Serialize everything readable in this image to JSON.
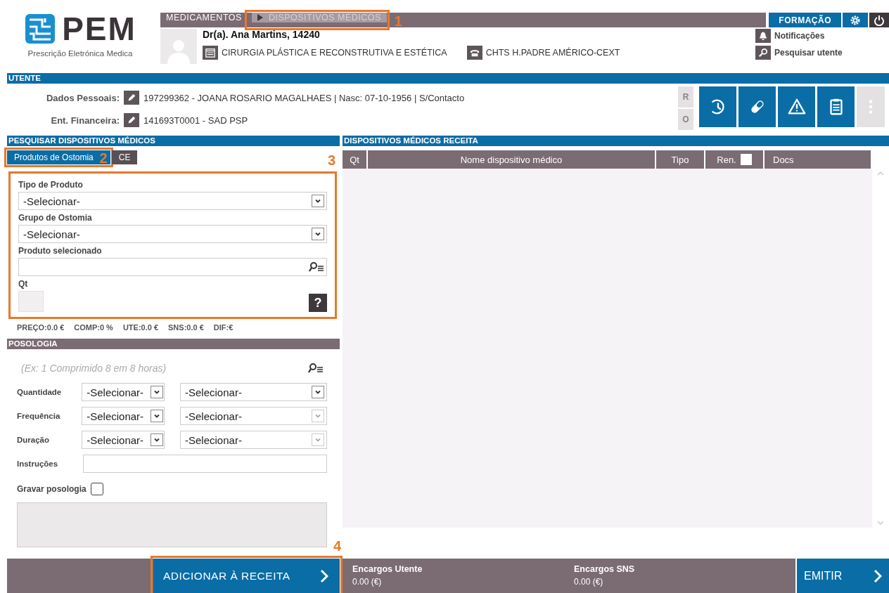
{
  "logo": {
    "name": "PEM",
    "subtitle": "Prescrição Eletrónica Medica"
  },
  "nav_tabs": [
    {
      "label": "MEDICAMENTOS",
      "selected": false
    },
    {
      "label": "DISPOSITIVOS MÉDICOS",
      "selected": true,
      "callout": "1"
    }
  ],
  "training_button": "FORMAÇÃO",
  "prescriber": {
    "name": "Dr(a). Ana Martins, 14240",
    "specialty": "CIRURGIA PLÁSTICA E RECONSTRUTIVA E ESTÉTICA",
    "location": "CHTS H.PADRE AMÉRICO-CEXT"
  },
  "links": [
    {
      "label": "Notificações",
      "kind": "bell"
    },
    {
      "label": "Pesquisar utente",
      "kind": "search"
    }
  ],
  "patient": {
    "title": "UTENTE",
    "rows": [
      {
        "label": "Dados Pessoais:",
        "value": "197299362 - JOANA ROSARIO MAGALHAES | Nasc: 07-10-1956 | S/Contacto"
      },
      {
        "label": "Ent. Financeira:",
        "value": "141693T0001 - SAD PSP"
      }
    ],
    "side_letters": [
      {
        "label": "R",
        "disabled": true
      },
      {
        "label": "O",
        "disabled": true
      }
    ],
    "actions": [
      {
        "kind": "history",
        "disabled": false
      },
      {
        "kind": "pill",
        "disabled": false
      },
      {
        "kind": "warning",
        "disabled": false
      },
      {
        "kind": "clipboard",
        "disabled": false
      },
      {
        "kind": "more",
        "disabled": true
      }
    ]
  },
  "search_panel": {
    "title": "PESQUISAR DISPOSITIVOS MÉDICOS",
    "tabs": [
      {
        "label": "Produtos de Ostomia",
        "selected": true,
        "callout": "2"
      },
      {
        "label": "CE",
        "selected": false
      }
    ],
    "callout": "3",
    "fields": [
      {
        "kind": "select",
        "label": "Tipo de Produto",
        "value": "-Selecionar-"
      },
      {
        "kind": "select",
        "label": "Grupo de Ostomia",
        "value": "-Selecionar-"
      },
      {
        "kind": "search",
        "label": "Produto selecionado"
      },
      {
        "kind": "qty",
        "label": "Qt",
        "help": "?"
      }
    ],
    "totals": [
      "PREÇO:0.0 €",
      "COMP:0 %",
      "UTE:0.0 €",
      "SNS:0.0 €",
      "DIF:€"
    ]
  },
  "posology": {
    "title": "POSOLOGIA",
    "placeholder": "(Ex: 1 Comprimido 8 em 8 horas)",
    "rows": [
      {
        "label": "Quantidade",
        "first": "-Selecionar-",
        "second": "-Selecionar-",
        "second_disabled": false
      },
      {
        "label": "Frequência",
        "first": "-Selecionar-",
        "second": "-Selecionar-",
        "second_disabled": true
      },
      {
        "label": "Duração",
        "first": "-Selecionar-",
        "second": "-Selecionar-",
        "second_disabled": true
      }
    ],
    "instructions_label": "Instruções",
    "save_label": "Gravar posologia",
    "save_checked": false
  },
  "prescription": {
    "title": "DISPOSITIVOS MÉDICOS RECEITA",
    "columns": [
      "Qt",
      "Nome dispositivo médico",
      "Tipo",
      "Ren.",
      "Docs"
    ],
    "renew_checked": false
  },
  "footer": {
    "add_button": "ADICIONAR À RECEITA",
    "add_callout": "4",
    "charges": [
      {
        "label": "Encargos Utente",
        "value": "0.00 (€)"
      },
      {
        "label": "Encargos SNS",
        "value": "0.00 (€)"
      }
    ],
    "emit_button": "EMITIR"
  }
}
